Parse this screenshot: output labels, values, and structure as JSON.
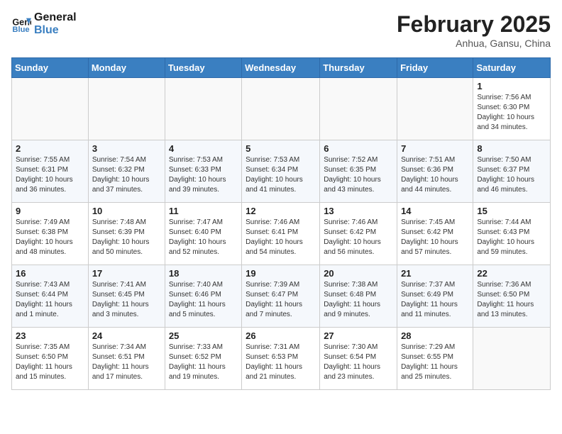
{
  "header": {
    "logo_line1": "General",
    "logo_line2": "Blue",
    "title": "February 2025",
    "subtitle": "Anhua, Gansu, China"
  },
  "weekdays": [
    "Sunday",
    "Monday",
    "Tuesday",
    "Wednesday",
    "Thursday",
    "Friday",
    "Saturday"
  ],
  "weeks": [
    [
      {
        "day": "",
        "info": ""
      },
      {
        "day": "",
        "info": ""
      },
      {
        "day": "",
        "info": ""
      },
      {
        "day": "",
        "info": ""
      },
      {
        "day": "",
        "info": ""
      },
      {
        "day": "",
        "info": ""
      },
      {
        "day": "1",
        "info": "Sunrise: 7:56 AM\nSunset: 6:30 PM\nDaylight: 10 hours\nand 34 minutes."
      }
    ],
    [
      {
        "day": "2",
        "info": "Sunrise: 7:55 AM\nSunset: 6:31 PM\nDaylight: 10 hours\nand 36 minutes."
      },
      {
        "day": "3",
        "info": "Sunrise: 7:54 AM\nSunset: 6:32 PM\nDaylight: 10 hours\nand 37 minutes."
      },
      {
        "day": "4",
        "info": "Sunrise: 7:53 AM\nSunset: 6:33 PM\nDaylight: 10 hours\nand 39 minutes."
      },
      {
        "day": "5",
        "info": "Sunrise: 7:53 AM\nSunset: 6:34 PM\nDaylight: 10 hours\nand 41 minutes."
      },
      {
        "day": "6",
        "info": "Sunrise: 7:52 AM\nSunset: 6:35 PM\nDaylight: 10 hours\nand 43 minutes."
      },
      {
        "day": "7",
        "info": "Sunrise: 7:51 AM\nSunset: 6:36 PM\nDaylight: 10 hours\nand 44 minutes."
      },
      {
        "day": "8",
        "info": "Sunrise: 7:50 AM\nSunset: 6:37 PM\nDaylight: 10 hours\nand 46 minutes."
      }
    ],
    [
      {
        "day": "9",
        "info": "Sunrise: 7:49 AM\nSunset: 6:38 PM\nDaylight: 10 hours\nand 48 minutes."
      },
      {
        "day": "10",
        "info": "Sunrise: 7:48 AM\nSunset: 6:39 PM\nDaylight: 10 hours\nand 50 minutes."
      },
      {
        "day": "11",
        "info": "Sunrise: 7:47 AM\nSunset: 6:40 PM\nDaylight: 10 hours\nand 52 minutes."
      },
      {
        "day": "12",
        "info": "Sunrise: 7:46 AM\nSunset: 6:41 PM\nDaylight: 10 hours\nand 54 minutes."
      },
      {
        "day": "13",
        "info": "Sunrise: 7:46 AM\nSunset: 6:42 PM\nDaylight: 10 hours\nand 56 minutes."
      },
      {
        "day": "14",
        "info": "Sunrise: 7:45 AM\nSunset: 6:42 PM\nDaylight: 10 hours\nand 57 minutes."
      },
      {
        "day": "15",
        "info": "Sunrise: 7:44 AM\nSunset: 6:43 PM\nDaylight: 10 hours\nand 59 minutes."
      }
    ],
    [
      {
        "day": "16",
        "info": "Sunrise: 7:43 AM\nSunset: 6:44 PM\nDaylight: 11 hours\nand 1 minute."
      },
      {
        "day": "17",
        "info": "Sunrise: 7:41 AM\nSunset: 6:45 PM\nDaylight: 11 hours\nand 3 minutes."
      },
      {
        "day": "18",
        "info": "Sunrise: 7:40 AM\nSunset: 6:46 PM\nDaylight: 11 hours\nand 5 minutes."
      },
      {
        "day": "19",
        "info": "Sunrise: 7:39 AM\nSunset: 6:47 PM\nDaylight: 11 hours\nand 7 minutes."
      },
      {
        "day": "20",
        "info": "Sunrise: 7:38 AM\nSunset: 6:48 PM\nDaylight: 11 hours\nand 9 minutes."
      },
      {
        "day": "21",
        "info": "Sunrise: 7:37 AM\nSunset: 6:49 PM\nDaylight: 11 hours\nand 11 minutes."
      },
      {
        "day": "22",
        "info": "Sunrise: 7:36 AM\nSunset: 6:50 PM\nDaylight: 11 hours\nand 13 minutes."
      }
    ],
    [
      {
        "day": "23",
        "info": "Sunrise: 7:35 AM\nSunset: 6:50 PM\nDaylight: 11 hours\nand 15 minutes."
      },
      {
        "day": "24",
        "info": "Sunrise: 7:34 AM\nSunset: 6:51 PM\nDaylight: 11 hours\nand 17 minutes."
      },
      {
        "day": "25",
        "info": "Sunrise: 7:33 AM\nSunset: 6:52 PM\nDaylight: 11 hours\nand 19 minutes."
      },
      {
        "day": "26",
        "info": "Sunrise: 7:31 AM\nSunset: 6:53 PM\nDaylight: 11 hours\nand 21 minutes."
      },
      {
        "day": "27",
        "info": "Sunrise: 7:30 AM\nSunset: 6:54 PM\nDaylight: 11 hours\nand 23 minutes."
      },
      {
        "day": "28",
        "info": "Sunrise: 7:29 AM\nSunset: 6:55 PM\nDaylight: 11 hours\nand 25 minutes."
      },
      {
        "day": "",
        "info": ""
      }
    ]
  ]
}
